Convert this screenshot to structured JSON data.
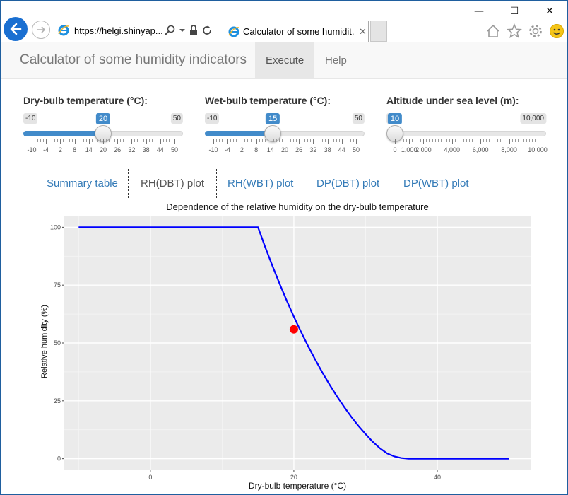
{
  "browser": {
    "url": "https://helgi.shinyap...",
    "tab_title": "Calculator of some humidit...",
    "tab_close": "✕"
  },
  "navbar": {
    "brand": "Calculator of some humidity indicators",
    "items": [
      {
        "label": "Execute",
        "active": true
      },
      {
        "label": "Help",
        "active": false
      }
    ]
  },
  "sliders": [
    {
      "label": "Dry-bulb temperature (°C):",
      "min": "-10",
      "max": "50",
      "value": "20",
      "value_fraction": 0.5,
      "ticks": [
        "-10",
        "-4",
        "2",
        "8",
        "14",
        "20",
        "26",
        "32",
        "38",
        "44",
        "50"
      ]
    },
    {
      "label": "Wet-bulb temperature (°C):",
      "min": "-10",
      "max": "50",
      "value": "15",
      "value_fraction": 0.4167,
      "ticks": [
        "-10",
        "-4",
        "2",
        "8",
        "14",
        "20",
        "26",
        "32",
        "38",
        "44",
        "50"
      ]
    },
    {
      "label": "Altitude under sea level (m):",
      "min": "10",
      "max": "10,000",
      "value": "10",
      "value_fraction": 0.0,
      "ticks": [
        "0",
        "1,000",
        "2,000",
        "4,000",
        "6,000",
        "8,000",
        "10,000"
      ]
    }
  ],
  "tabs": [
    {
      "label": "Summary table",
      "active": false
    },
    {
      "label": "RH(DBT) plot",
      "active": true
    },
    {
      "label": "RH(WBT) plot",
      "active": false
    },
    {
      "label": "DP(DBT) plot",
      "active": false
    },
    {
      "label": "DP(WBT) plot",
      "active": false
    }
  ],
  "chart_data": {
    "type": "line",
    "title": "Dependence of the relative humidity on the dry-bulb temperature",
    "xlabel": "Dry-bulb temperature (°C)",
    "ylabel": "Relative humidity (%)",
    "xlim": [
      -12,
      53
    ],
    "ylim": [
      -5,
      105
    ],
    "x_ticks": [
      0,
      20,
      40
    ],
    "y_ticks": [
      0,
      25,
      50,
      75,
      100
    ],
    "grid": true,
    "series": [
      {
        "color": "#0000ff",
        "x": [
          -10,
          15,
          16,
          17,
          18,
          19,
          20,
          21,
          22,
          23,
          24,
          25,
          26,
          27,
          28,
          29,
          30,
          31,
          32,
          33,
          34,
          35,
          36,
          50
        ],
        "y": [
          100,
          100,
          91.5,
          83.4,
          75.7,
          68.3,
          61.4,
          54.8,
          48.6,
          42.7,
          37.1,
          31.9,
          27.0,
          22.4,
          18.1,
          14.2,
          10.6,
          7.3,
          4.5,
          2.3,
          1.0,
          0.3,
          0,
          0
        ]
      }
    ],
    "point": {
      "x": 20,
      "y": 55.9,
      "color": "#ff0000"
    }
  }
}
